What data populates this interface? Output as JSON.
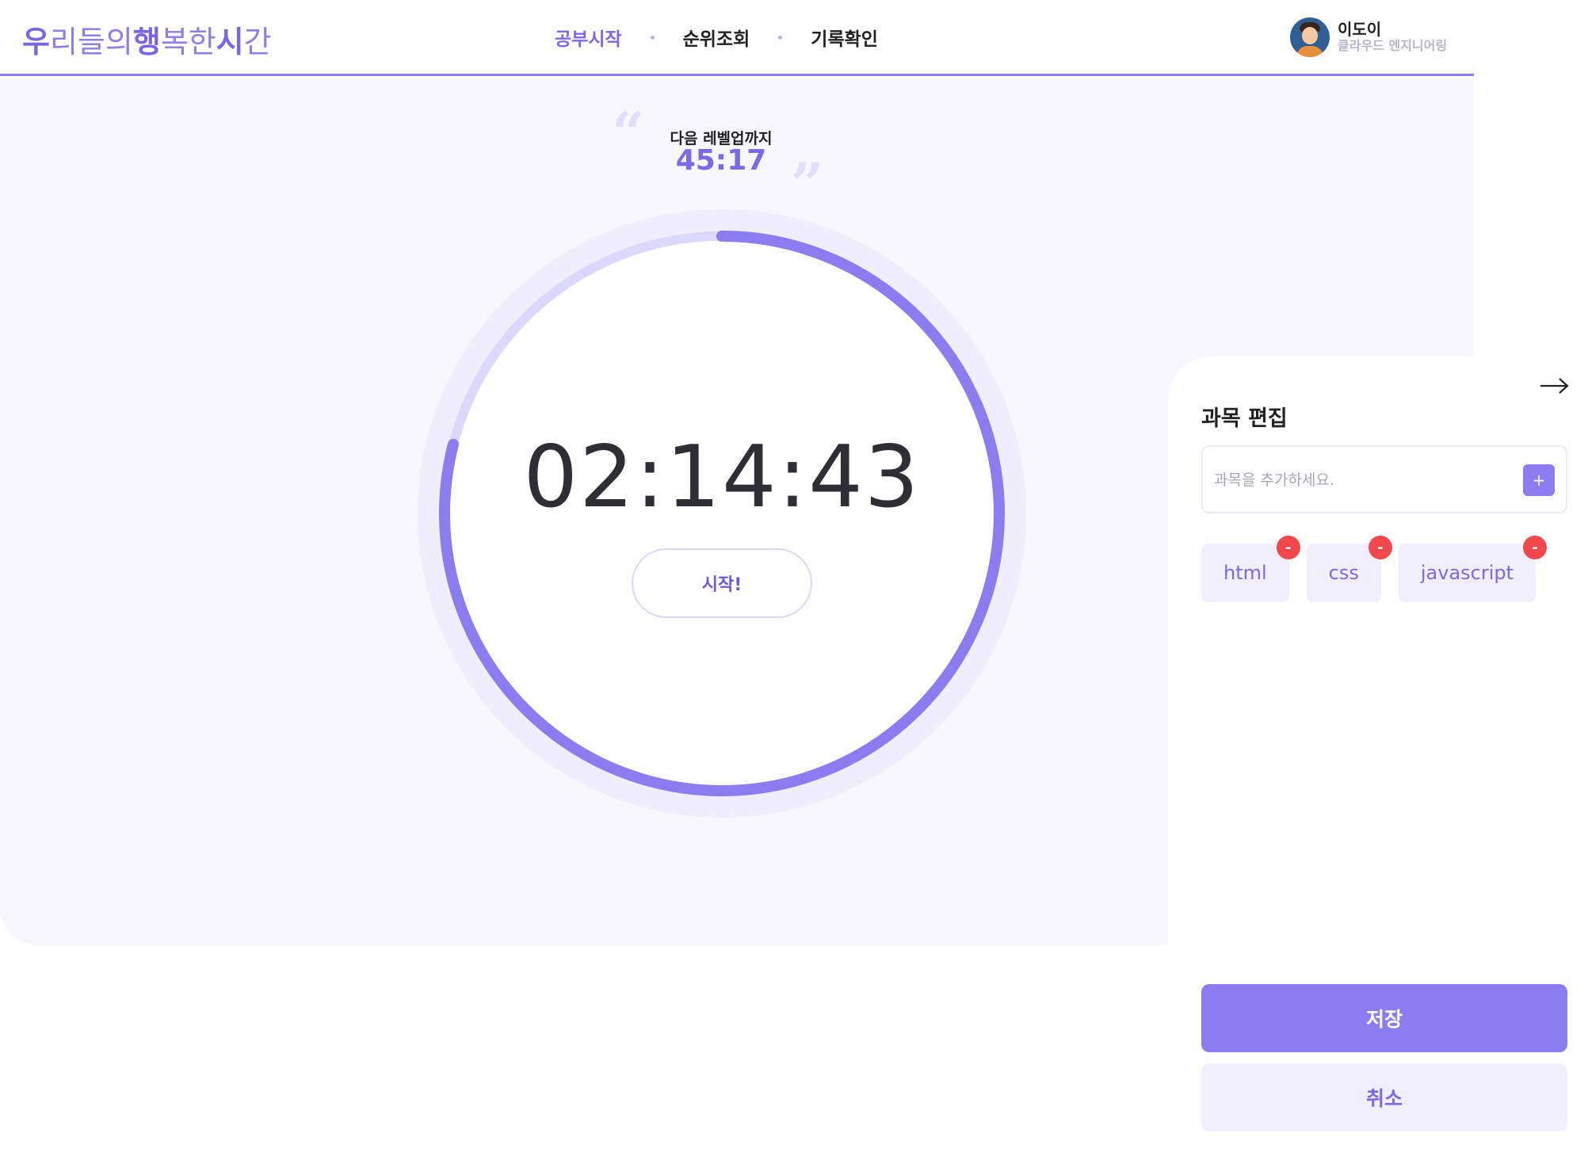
{
  "brand": {
    "logo_parts": [
      {
        "text": "우",
        "bold": true
      },
      {
        "text": "리들의",
        "bold": false
      },
      {
        "text": "행",
        "bold": true
      },
      {
        "text": "복한",
        "bold": false
      },
      {
        "text": "시",
        "bold": true
      },
      {
        "text": "간",
        "bold": false
      }
    ]
  },
  "nav": {
    "items": [
      {
        "label": "공부시작",
        "active": true
      },
      {
        "label": "순위조회",
        "active": false
      },
      {
        "label": "기록확인",
        "active": false
      }
    ]
  },
  "user": {
    "name": "이도이",
    "team": "클라우드 엔지니어링",
    "avatar_icon": "user-avatar-icon"
  },
  "level": {
    "label": "다음 레벨업까지",
    "time": "45:17"
  },
  "timer": {
    "display": "02:14:43",
    "start_label": "시작!",
    "progress_fraction": 0.79
  },
  "panel": {
    "title": "과목 편집",
    "close_icon": "arrow-right-icon",
    "input_placeholder": "과목을 추가하세요.",
    "input_value": "",
    "add_label": "+",
    "subjects": [
      "html",
      "css",
      "javascript"
    ],
    "remove_label": "-",
    "save_label": "저장",
    "cancel_label": "취소"
  },
  "colors": {
    "accent": "#8b7cf0",
    "accent_text": "#7a6ae6",
    "ring_track": "#dcd8fb",
    "halo": "#f0eefc",
    "stage_bg": "#f8f7fe",
    "danger": "#f2484c"
  }
}
